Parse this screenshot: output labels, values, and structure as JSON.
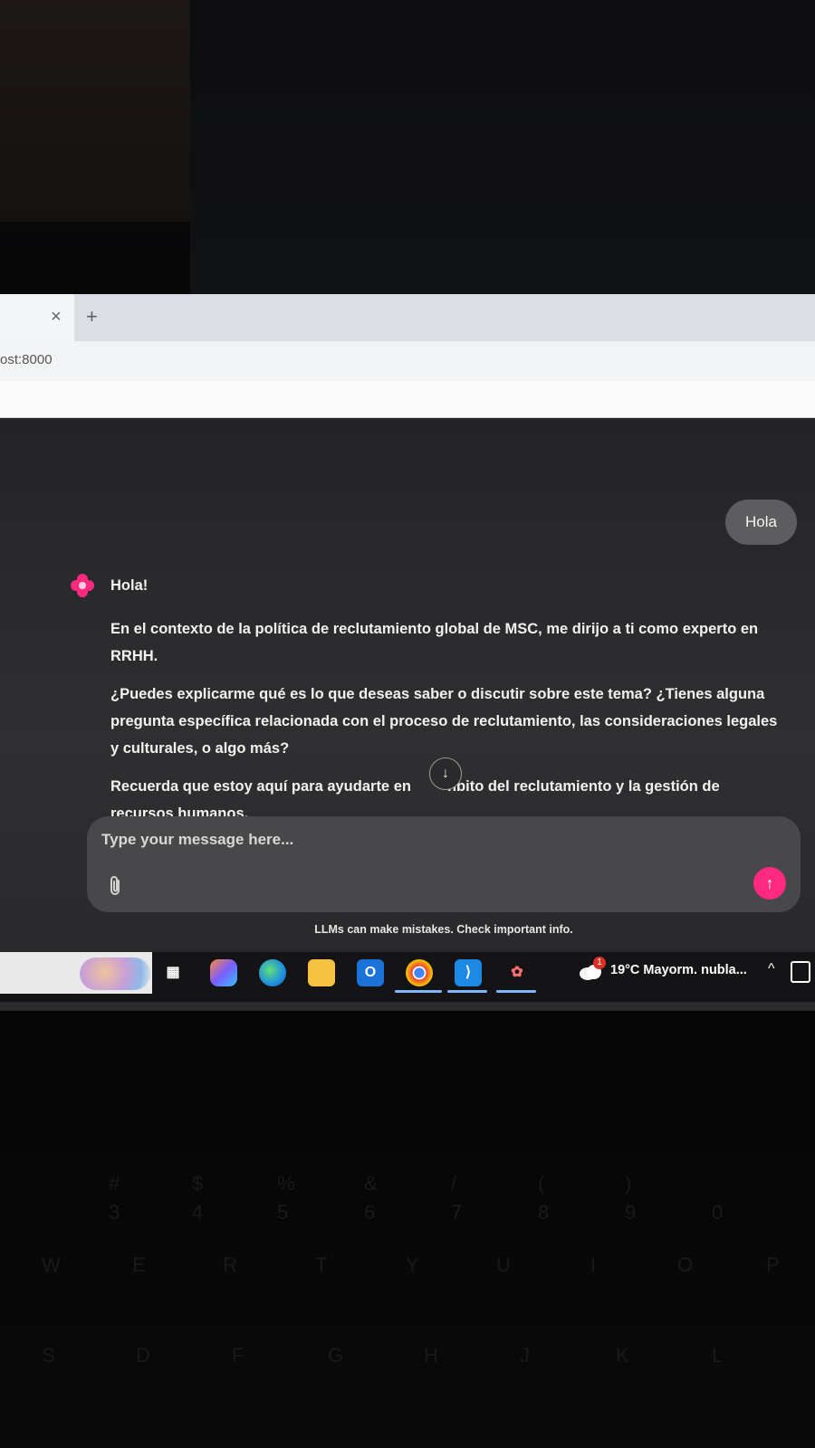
{
  "browser": {
    "tab_close_label": "×",
    "new_tab_label": "+",
    "url": "ost:8000"
  },
  "chat": {
    "user_message": "Hola",
    "assistant": {
      "greeting": "Hola!",
      "paragraphs": [
        "En el contexto de la política de reclutamiento global de MSC, me dirijo a ti como experto en RRHH.",
        "¿Puedes explicarme qué es lo que deseas saber o discutir sobre este tema? ¿Tienes alguna pregunta específica relacionada con el proceso de reclutamiento, las consideraciones legales y culturales, o algo más?"
      ],
      "last_before": "Recuerda que estoy aquí para ayudarte en",
      "last_after": "nbito del reclutamiento y la gestión de",
      "last_line2": "recursos humanos."
    },
    "scroll_down_icon": "↓",
    "composer": {
      "placeholder": "Type your message here...",
      "send_icon": "↑"
    },
    "disclaimer": "LLMs can make mistakes. Check important info."
  },
  "taskbar": {
    "weather_badge": "1",
    "weather_text": "19°C  Mayorm. nubla...",
    "tray_chevron": "^"
  },
  "keyboard": {
    "row1": [
      "#",
      "$",
      "%",
      "&",
      "/",
      "(",
      ")"
    ],
    "row1_numbers": [
      "3",
      "4",
      "5",
      "6",
      "7",
      "8",
      "9",
      "0"
    ],
    "row2": [
      "W",
      "E",
      "R",
      "T",
      "Y",
      "U",
      "I",
      "O",
      "P"
    ],
    "row3": [
      "S",
      "D",
      "F",
      "G",
      "H",
      "J",
      "K",
      "L"
    ]
  },
  "colors": {
    "accent": "#ff2a7f",
    "page_bg": "#2b2b2d",
    "composer_bg": "#48484b",
    "user_bubble": "#5d5d60"
  }
}
